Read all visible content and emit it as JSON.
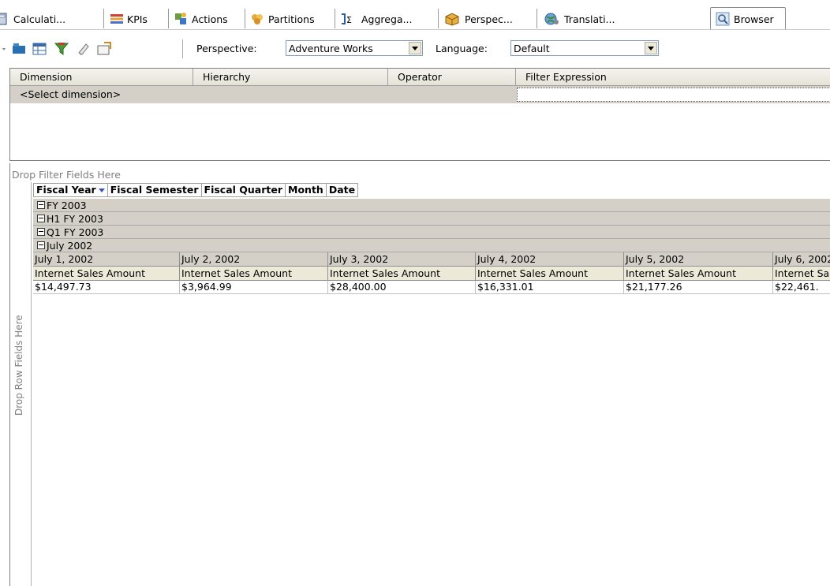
{
  "tabs": [
    {
      "label": "Calculati...",
      "icon": "calculations-icon"
    },
    {
      "label": "KPIs",
      "icon": "kpi-icon"
    },
    {
      "label": "Actions",
      "icon": "actions-icon"
    },
    {
      "label": "Partitions",
      "icon": "partitions-icon"
    },
    {
      "label": "Aggrega...",
      "icon": "aggregations-icon"
    },
    {
      "label": "Perspec...",
      "icon": "perspectives-icon"
    },
    {
      "label": "Translati...",
      "icon": "translations-icon"
    },
    {
      "label": "Browser",
      "icon": "browser-icon"
    }
  ],
  "toolbar": {
    "perspective_label": "Perspective:",
    "perspective_value": "Adventure Works",
    "language_label": "Language:",
    "language_value": "Default"
  },
  "filter_grid": {
    "columns": [
      "Dimension",
      "Hierarchy",
      "Operator",
      "Filter Expression"
    ],
    "row": {
      "dimension": "<Select dimension>"
    }
  },
  "pivot": {
    "drop_filter": "Drop Filter Fields Here",
    "drop_row": "Drop Row Fields Here",
    "dimension_fields": [
      "Fiscal Year",
      "Fiscal Semester",
      "Fiscal Quarter",
      "Month",
      "Date"
    ],
    "groups": [
      "FY 2003",
      "H1 FY 2003",
      "Q1 FY 2003",
      "July 2002"
    ],
    "dates": [
      "July 1, 2002",
      "July 2, 2002",
      "July 3, 2002",
      "July 4, 2002",
      "July 5, 2002",
      "July 6, 2002"
    ],
    "measure": "Internet Sales Amount",
    "values": [
      "$14,497.73",
      "$3,964.99",
      "$28,400.00",
      "$16,331.01",
      "$21,177.26",
      "$22,461."
    ]
  },
  "colors": {
    "grid_header": "#d4d0c8",
    "measure_header": "#ece9d8",
    "sort_arrow": "#3355cc"
  }
}
